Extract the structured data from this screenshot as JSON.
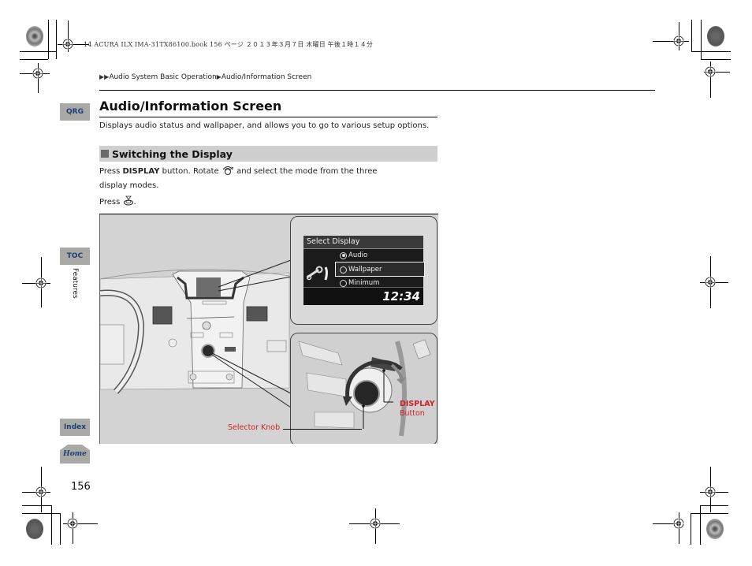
{
  "print_header": "14 ACURA ILX IMA-31TX86100.book  156 ページ  ２０１３年３月７日  木曜日  午後１時１４分",
  "breadcrumb": {
    "items": [
      "Audio System Basic Operation",
      "Audio/Information Screen"
    ]
  },
  "side_tabs": {
    "qrg": "QRG",
    "toc": "TOC",
    "chapter": "Features",
    "index": "Index",
    "home": "Home"
  },
  "page": {
    "title": "Audio/Information Screen",
    "intro": "Displays audio status and wallpaper, and allows you to go to various setup options.",
    "section": {
      "title": "Switching the Display",
      "step1": {
        "prefix": "Press ",
        "button": "DISPLAY",
        "middle": " button. Rotate ",
        "icon": "rotate-knob-icon",
        "suffix": " and select the mode from the three",
        "line2": "display modes."
      },
      "step2": {
        "prefix": "Press ",
        "icon": "press-knob-icon",
        "suffix": "."
      }
    },
    "page_number": "156"
  },
  "figure": {
    "screen": {
      "header": "Select Display",
      "options": [
        {
          "label": "Audio",
          "selected_radio": true
        },
        {
          "label": "Wallpaper",
          "selected_radio": false,
          "highlighted": true
        },
        {
          "label": "Minimum",
          "selected_radio": false
        }
      ],
      "clock": "12:34",
      "icon": "wrench-icon"
    },
    "labels": {
      "selector_knob": "Selector Knob",
      "display_button_line1": "DISPLAY",
      "display_button_line2": "Button"
    }
  },
  "colors": {
    "tab_bg": "#a9a9a5",
    "tab_text": "#1d3f7a",
    "section_bar": "#cfcfcf",
    "callout_red": "#d0202a"
  }
}
